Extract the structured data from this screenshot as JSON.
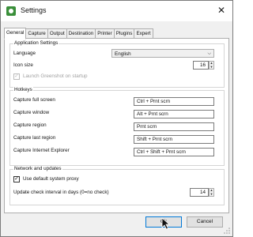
{
  "window": {
    "title": "Settings",
    "close_glyph": "✕"
  },
  "tabs": [
    {
      "label": "General",
      "active": true
    },
    {
      "label": "Capture"
    },
    {
      "label": "Output"
    },
    {
      "label": "Destination"
    },
    {
      "label": "Printer"
    },
    {
      "label": "Plugins"
    },
    {
      "label": "Expert"
    }
  ],
  "app_settings": {
    "title": "Application Settings",
    "language_label": "Language",
    "language_value": "English",
    "icon_size_label": "Icon size",
    "icon_size_value": "16",
    "launch_label": "Launch Greenshot on startup",
    "launch_checked": true,
    "launch_enabled": false
  },
  "hotkeys": {
    "title": "Hotkeys",
    "items": [
      {
        "label": "Capture full screen",
        "value": "Ctrl + Prnt scrn"
      },
      {
        "label": "Capture window",
        "value": "Alt + Prnt scrn"
      },
      {
        "label": "Capture region",
        "value": "Prnt scrn"
      },
      {
        "label": "Capture last region",
        "value": "Shift + Prnt scrn"
      },
      {
        "label": "Capture Internet Explorer",
        "value": "Ctrl + Shift + Prnt scrn"
      }
    ]
  },
  "network": {
    "title": "Network and updates",
    "proxy_label": "Use default system proxy",
    "proxy_checked": true,
    "interval_label": "Update check interval in days (0=no check)",
    "interval_value": "14"
  },
  "buttons": {
    "ok": "Ok",
    "cancel": "Cancel"
  },
  "icons": {
    "app": "greenshot-app-icon",
    "close": "close-icon",
    "dropdown": "chevron-down-icon",
    "cursor": "mouse-pointer-icon",
    "grip": "resize-grip-icon"
  },
  "colors": {
    "title_bg": "#ffffff",
    "dialog_bg": "#f0f0f0",
    "default_button_border": "#0078d7"
  }
}
